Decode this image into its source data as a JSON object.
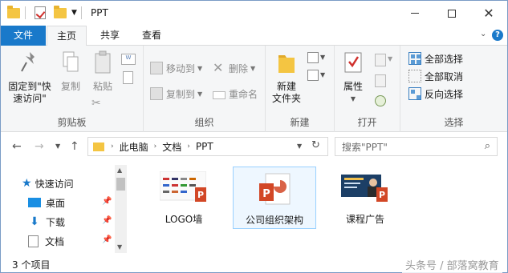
{
  "window": {
    "title": "PPT"
  },
  "tabs": {
    "file": "文件",
    "home": "主页",
    "share": "共享",
    "view": "查看"
  },
  "ribbon": {
    "clipboard": {
      "label": "剪贴板",
      "pin_label": "固定到\"快速访问\"",
      "copy_label": "复制",
      "paste_label": "粘贴"
    },
    "organize": {
      "label": "组织",
      "move_to": "移动到",
      "copy_to": "复制到",
      "delete": "删除",
      "rename": "重命名"
    },
    "new": {
      "label": "新建",
      "new_folder": "新建\n文件夹"
    },
    "open": {
      "label": "打开",
      "properties": "属性"
    },
    "select": {
      "label": "选择",
      "select_all": "全部选择",
      "select_none": "全部取消",
      "invert": "反向选择"
    }
  },
  "address": {
    "breadcrumbs": [
      "此电脑",
      "文档",
      "PPT"
    ],
    "search_placeholder": "搜索\"PPT\""
  },
  "nav": {
    "items": [
      {
        "label": "快速访问",
        "icon": "star-icon"
      },
      {
        "label": "桌面",
        "icon": "desktop-icon"
      },
      {
        "label": "下载",
        "icon": "download-icon"
      },
      {
        "label": "文档",
        "icon": "documents-icon"
      }
    ]
  },
  "files": [
    {
      "name": "LOGO墙",
      "icon": "ppt-thumbnail-logo-wall"
    },
    {
      "name": "公司组织架构",
      "icon": "ppt-file-icon",
      "selected": true
    },
    {
      "name": "课程广告",
      "icon": "ppt-thumbnail-course-ad"
    }
  ],
  "status": {
    "item_count": "3 个项目"
  },
  "watermark": "头条号 / 部落窝教育",
  "colors": {
    "accent": "#1979ca",
    "ppt_orange": "#d24726",
    "folder": "#f4c542"
  }
}
